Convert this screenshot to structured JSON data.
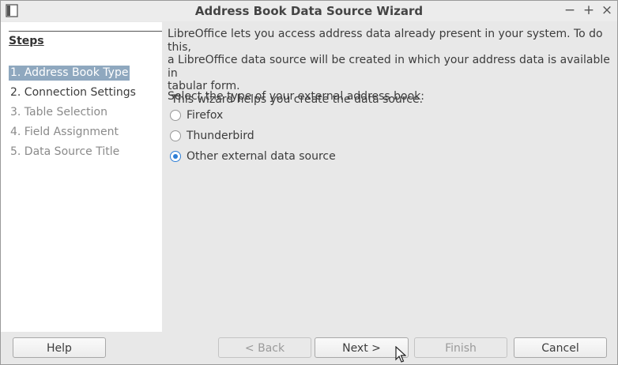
{
  "window": {
    "title": "Address Book Data Source Wizard",
    "controls": {
      "minimize": "−",
      "maximize": "+",
      "close": "×"
    }
  },
  "sidebar": {
    "heading": "Steps",
    "items": [
      {
        "label": "1. Address Book Type",
        "state": "active"
      },
      {
        "label": "2. Connection Settings",
        "state": "enabled"
      },
      {
        "label": "3. Table Selection",
        "state": "disabled"
      },
      {
        "label": "4. Field Assignment",
        "state": "disabled"
      },
      {
        "label": "5. Data Source Title",
        "state": "disabled"
      }
    ]
  },
  "main": {
    "description_line1": "LibreOffice lets you access address data already present in your system. To do this,",
    "description_line2": "a LibreOffice data source will be created in which your address data is available in",
    "description_line3": "tabular form.",
    "description_line4": " This wizard helps you create the data source.",
    "prompt": "Select the type of your external address book:",
    "options": [
      {
        "label": "Firefox",
        "checked": false
      },
      {
        "label": "Thunderbird",
        "checked": false
      },
      {
        "label": "Other external data source",
        "checked": true
      }
    ]
  },
  "buttons": {
    "help": "Help",
    "back": "< Back",
    "next": "Next >",
    "finish": "Finish",
    "cancel": "Cancel"
  },
  "colors": {
    "selection": "#8fa8bf",
    "radio_accent": "#2f7fd6"
  }
}
